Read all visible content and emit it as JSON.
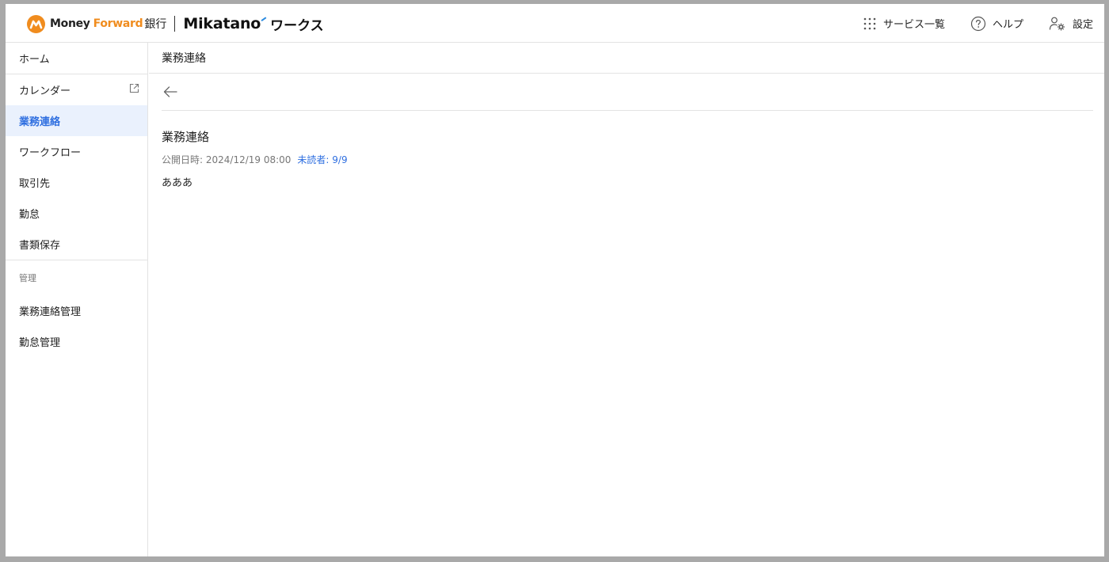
{
  "header": {
    "logo_money": "Money",
    "logo_forward": "Forward",
    "logo_bank": "銀行",
    "logo_mikatano": "Mikatano",
    "logo_works": "ワークス",
    "nav": {
      "services_label": "サービス一覧",
      "help_label": "ヘルプ",
      "settings_label": "設定"
    }
  },
  "sidebar": {
    "items": [
      {
        "label": "ホーム"
      },
      {
        "label": "カレンダー"
      },
      {
        "label": "業務連絡"
      },
      {
        "label": "ワークフロー"
      },
      {
        "label": "取引先"
      },
      {
        "label": "勤怠"
      },
      {
        "label": "書類保存"
      }
    ],
    "admin_section_label": "管理",
    "admin_items": [
      {
        "label": "業務連絡管理"
      },
      {
        "label": "勤怠管理"
      }
    ]
  },
  "main": {
    "page_title": "業務連絡",
    "article": {
      "title": "業務連絡",
      "published": "公開日時: 2024/12/19 08:00",
      "unread": "未読者: 9/9",
      "body": "あああ"
    }
  },
  "colors": {
    "accent": "#2f6fe0",
    "brand_orange": "#f08c1e",
    "active_bg": "#eaf1fd"
  }
}
